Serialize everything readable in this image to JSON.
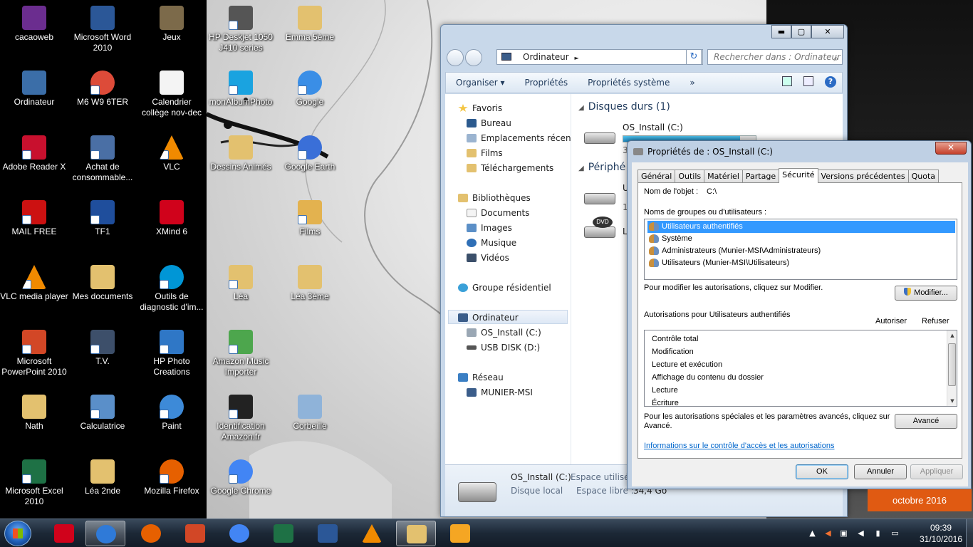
{
  "desktop": {
    "icons": [
      {
        "name": "cacaoweb",
        "color": "#6b2d8f"
      },
      {
        "name": "Microsoft Word 2010",
        "color": "#2b5797"
      },
      {
        "name": "Jeux",
        "color": "#7c6a4a"
      },
      {
        "name": "HP Deskjet 1050 J410 series",
        "color": "#555555"
      },
      {
        "name": "Emma 5ème",
        "color": "#e3c16f"
      },
      {
        "name": "Ordinateur",
        "color": "#3b6ea8"
      },
      {
        "name": "M6 W9 6TER",
        "color": "#dd4b39"
      },
      {
        "name": "Calendrier collège nov-dec",
        "color": "#f4f4f4"
      },
      {
        "name": "monAlbumPhoto",
        "color": "#1aa3e0"
      },
      {
        "name": "Google",
        "color": "#3a8ee6"
      },
      {
        "name": "Adobe Reader X",
        "color": "#c8102e"
      },
      {
        "name": "Achat de consommable...",
        "color": "#4a6fa5"
      },
      {
        "name": "VLC",
        "color": "#f08a00"
      },
      {
        "name": "Dessins Animés",
        "color": "#e3c16f"
      },
      {
        "name": "Google Earth",
        "color": "#3a6fd8"
      },
      {
        "name": "MAIL FREE",
        "color": "#cc1111"
      },
      {
        "name": "TF1",
        "color": "#1f4e9c"
      },
      {
        "name": "XMind 6",
        "color": "#d0021b"
      },
      {
        "name": "Films",
        "color": "#e3b24f"
      },
      {
        "name": "VLC media player",
        "color": "#f08a00"
      },
      {
        "name": "Mes documents",
        "color": "#e3c16f"
      },
      {
        "name": "Outils de diagnostic d'im...",
        "color": "#0096d6"
      },
      {
        "name": "Léa",
        "color": "#e3c16f"
      },
      {
        "name": "Léa 3ème",
        "color": "#e3c16f"
      },
      {
        "name": "Microsoft PowerPoint 2010",
        "color": "#d24726"
      },
      {
        "name": "T.V.",
        "color": "#3d4f6a"
      },
      {
        "name": "HP Photo Creations",
        "color": "#2f77c6"
      },
      {
        "name": "Amazon Music Importer",
        "color": "#4da64d"
      },
      {
        "name": "Nath",
        "color": "#e3c16f"
      },
      {
        "name": "Calculatrice",
        "color": "#5a8fc9"
      },
      {
        "name": "Paint",
        "color": "#3d8ad8"
      },
      {
        "name": "Identification Amazon.fr",
        "color": "#222222"
      },
      {
        "name": "Corbeille",
        "color": "#8fb3d9"
      },
      {
        "name": "Microsoft Excel 2010",
        "color": "#1e7145"
      },
      {
        "name": "Léa 2nde",
        "color": "#e3c16f"
      },
      {
        "name": "Mozilla Firefox",
        "color": "#e66000"
      },
      {
        "name": "Google Chrome",
        "color": "#4285f4"
      }
    ]
  },
  "explorer": {
    "title_buttons": {
      "minimize": "▬",
      "maximize": "▢",
      "close": "✕"
    },
    "address": {
      "crumb": "Ordinateur",
      "arrow": "►",
      "dropdown": "▼"
    },
    "search_placeholder": "Rechercher dans : Ordinateur",
    "toolbar": {
      "organize": "Organiser ▾",
      "properties": "Propriétés",
      "system_properties": "Propriétés système",
      "more": "»",
      "help": "?"
    },
    "nav": {
      "favorites": "Favoris",
      "desktop": "Bureau",
      "recent": "Emplacements récents",
      "films": "Films",
      "downloads": "Téléchargements",
      "libraries": "Bibliothèques",
      "documents": "Documents",
      "images": "Images",
      "music": "Musique",
      "videos": "Vidéos",
      "homegroup": "Groupe résidentiel",
      "computer": "Ordinateur",
      "os_drive": "OS_Install (C:)",
      "usb_drive": "USB DISK (D:)",
      "network": "Réseau",
      "network_pc": "MUNIER-MSI"
    },
    "content": {
      "hard_disks_header": "Disques durs (1)",
      "os_drive_name": "OS_Install (C:)",
      "os_drive_usage_fraction": 0.88,
      "removable_header": "Périphé",
      "dvd_label": "DVD",
      "fragment_u": "U",
      "fragment_l": "L",
      "fragment_1": "1",
      "fragment_3": "3"
    },
    "details": {
      "name": "OS_Install (C:)",
      "type": "Disque local",
      "used_label": "Espace utilisé :",
      "free_label": "Espace libre :",
      "free_value": "34,4 Go"
    }
  },
  "properties_dialog": {
    "title": "Propriétés de : OS_Install (C:)",
    "close": "✕",
    "tabs": [
      "Général",
      "Outils",
      "Matériel",
      "Partage",
      "Sécurité",
      "Versions précédentes",
      "Quota"
    ],
    "active_tab": "Sécurité",
    "object_name_label": "Nom de l'objet :",
    "object_name_value": "C:\\",
    "groups_label": "Noms de groupes ou d'utilisateurs :",
    "groups": [
      "Utilisateurs authentifiés",
      "Système",
      "Administrateurs (Munier-MSI\\Administrateurs)",
      "Utilisateurs (Munier-MSI\\Utilisateurs)"
    ],
    "modify_hint": "Pour modifier les autorisations, cliquez sur Modifier.",
    "modify_button": "Modifier...",
    "permissions_for": "Autorisations pour Utilisateurs authentifiés",
    "allow_header": "Autoriser",
    "deny_header": "Refuser",
    "permissions": [
      "Contrôle total",
      "Modification",
      "Lecture et exécution",
      "Affichage du contenu du dossier",
      "Lecture",
      "Écriture"
    ],
    "advanced_hint_line1": "Pour les autorisations spéciales et les paramètres avancés, cliquez sur",
    "advanced_hint_line2": "Avancé.",
    "advanced_button": "Avancé",
    "info_link": "Informations sur le contrôle d'accès et les autorisations",
    "ok": "OK",
    "cancel": "Annuler",
    "apply": "Appliquer"
  },
  "calendar": {
    "month": "octobre 2016"
  },
  "taskbar": {
    "apps": [
      {
        "name": "xmind",
        "color": "#d0021b"
      },
      {
        "name": "internet-explorer",
        "color": "#2f7ad8"
      },
      {
        "name": "firefox",
        "color": "#e66000"
      },
      {
        "name": "powerpoint",
        "color": "#d24726"
      },
      {
        "name": "chrome",
        "color": "#4285f4"
      },
      {
        "name": "excel",
        "color": "#1e7145"
      },
      {
        "name": "word",
        "color": "#2b5797"
      },
      {
        "name": "vlc",
        "color": "#f08a00"
      },
      {
        "name": "explorer",
        "color": "#e3c16f"
      },
      {
        "name": "media-player",
        "color": "#f5a623"
      }
    ],
    "clock_time": "09:39",
    "clock_date": "31/10/2016"
  }
}
